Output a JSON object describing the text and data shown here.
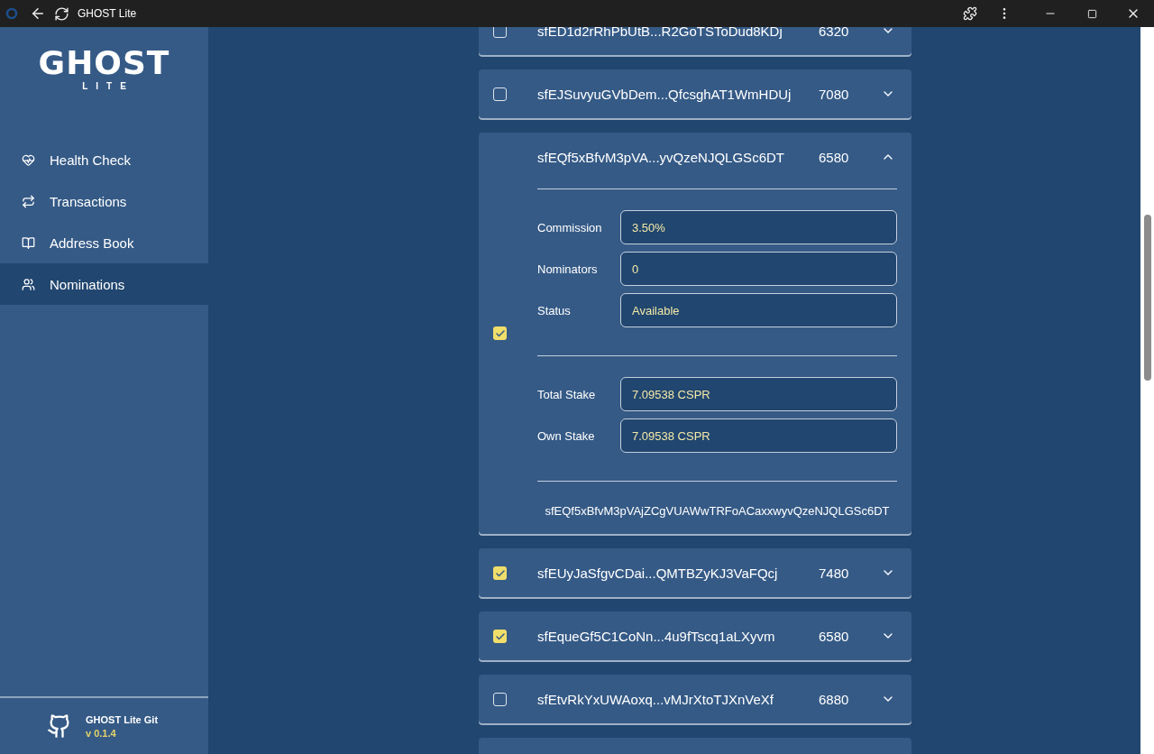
{
  "window": {
    "title": "GHOST Lite"
  },
  "sidebar": {
    "logo": {
      "title": "GHOST",
      "subtitle": "LITE"
    },
    "items": [
      {
        "label": "Health Check",
        "selected": false
      },
      {
        "label": "Transactions",
        "selected": false
      },
      {
        "label": "Address Book",
        "selected": false
      },
      {
        "label": "Nominations",
        "selected": true
      }
    ],
    "footer": {
      "title": "GHOST Lite Git",
      "version": "v 0.1.4"
    }
  },
  "validators": [
    {
      "kind": "validator",
      "address": "sfED1d2rRhPbUtB...R2GoTSToDud8KDj",
      "number": "6320",
      "checked": false,
      "expanded": false
    },
    {
      "kind": "validator",
      "address": "sfEJSuvyuGVbDem...QfcsghAT1WmHDUj",
      "number": "7080",
      "checked": false,
      "expanded": false
    },
    {
      "kind": "validator",
      "address": "sfEQf5xBfvM3pVA...yvQzeNJQLGSc6DT",
      "number": "6580",
      "checked": true,
      "expanded": true,
      "details": {
        "groups": [
          [
            {
              "label": "Commission",
              "value": "3.50%"
            },
            {
              "label": "Nominators",
              "value": "0"
            },
            {
              "label": "Status",
              "value": "Available"
            }
          ],
          [
            {
              "label": "Total Stake",
              "value": "7.09538 CSPR"
            },
            {
              "label": "Own Stake",
              "value": "7.09538 CSPR"
            }
          ]
        ],
        "full_address": "sfEQf5xBfvM3pVAjZCgVUAWwTRFoACaxxwyvQzeNJQLGSc6DT"
      }
    },
    {
      "kind": "validator",
      "address": "sfEUyJaSfgvCDai...QMTBZyKJ3VaFQcj",
      "number": "7480",
      "checked": true,
      "expanded": false
    },
    {
      "kind": "validator",
      "address": "sfEqueGf5C1CoNn...4u9fTscq1aLXyvm",
      "number": "6580",
      "checked": true,
      "expanded": false
    },
    {
      "kind": "validator",
      "address": "sfEtvRkYxUWAoxq...vMJrXtoTJXnVeXf",
      "number": "6880",
      "checked": false,
      "expanded": false
    },
    {
      "kind": "partial"
    }
  ]
}
